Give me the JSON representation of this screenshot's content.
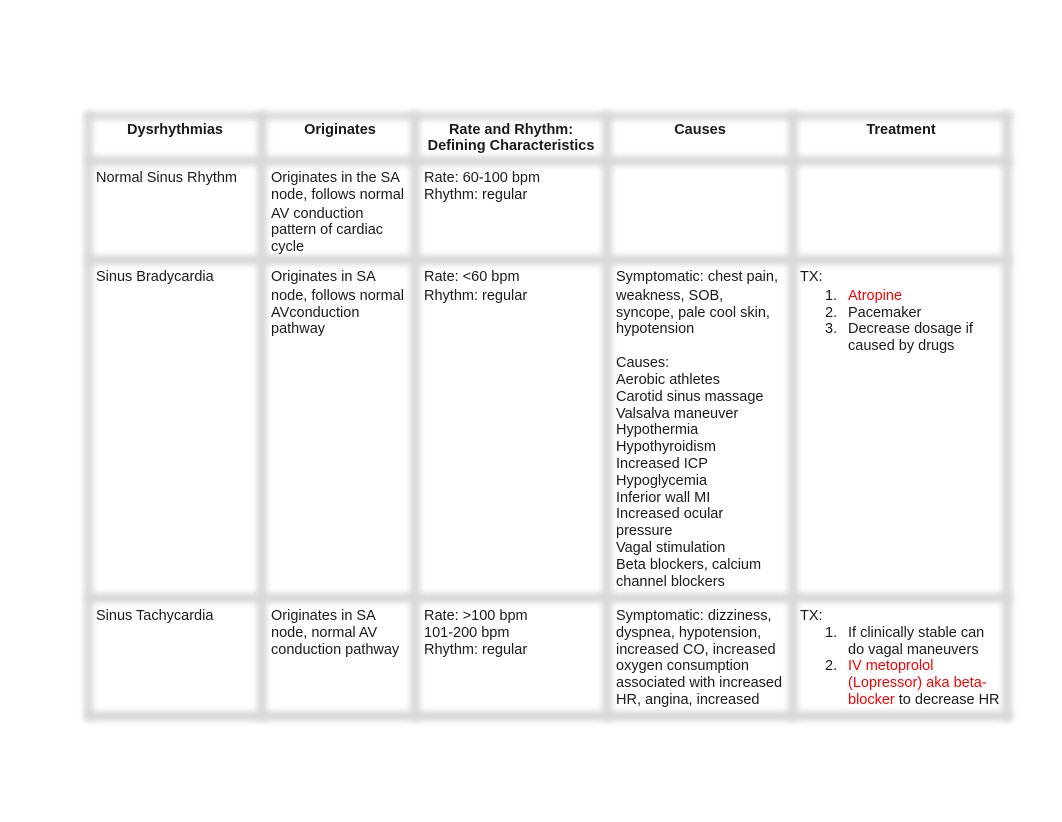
{
  "table": {
    "headers": [
      "Dysrhythmias",
      "Originates",
      "Rate and Rhythm: Defining Characteristics",
      "Causes",
      "Treatment"
    ],
    "header_rate_line1": "Rate and Rhythm:",
    "header_rate_line2": "Defining Characteristics",
    "rows": [
      {
        "name": "Normal Sinus Rhythm",
        "originates": [
          "Originates in the SA",
          "node, follows normal",
          "AV conduction",
          "pattern of cardiac",
          "cycle"
        ],
        "rate_rhythm": [
          "Rate: 60-100 bpm",
          "Rhythm: regular"
        ],
        "causes": [],
        "treatment": null
      },
      {
        "name": "Sinus Bradycardia",
        "originates": [
          "Originates in SA",
          "node, follows normal",
          "AVconduction",
          "pathway"
        ],
        "rate_rhythm": [
          "Rate: <60 bpm",
          "Rhythm: regular"
        ],
        "symptomatic": [
          "Symptomatic: chest pain,",
          "weakness, SOB,",
          "syncope, pale cool skin,",
          "hypotension"
        ],
        "causes_label": "Causes:",
        "causes": [
          "Aerobic athletes",
          "Carotid sinus massage",
          "Valsalva maneuver",
          "Hypothermia",
          "Hypothyroidism",
          "Increased ICP",
          "Hypoglycemia",
          "Inferior wall MI",
          "Increased ocular",
          "pressure",
          "Vagal stimulation",
          "Beta blockers, calcium",
          "channel blockers"
        ],
        "treatment": {
          "label": "TX:",
          "items": [
            {
              "num": "1.",
              "lines": [
                {
                  "text": "Atropine",
                  "red": true
                }
              ]
            },
            {
              "num": "2.",
              "lines": [
                {
                  "text": "Pacemaker",
                  "red": false
                }
              ]
            },
            {
              "num": "3.",
              "lines": [
                {
                  "text": "Decrease dosage if",
                  "red": false
                },
                {
                  "text": "caused by drugs",
                  "red": false
                }
              ]
            }
          ]
        }
      },
      {
        "name": "Sinus Tachycardia",
        "originates": [
          "Originates in SA",
          "node, normal AV",
          "conduction pathway"
        ],
        "rate_rhythm": [
          "Rate: >100 bpm",
          "101-200 bpm",
          "Rhythm: regular"
        ],
        "symptomatic": [
          "Symptomatic: dizziness,",
          "dyspnea, hypotension,",
          "increased CO, increased",
          "oxygen consumption",
          "associated with increased",
          "HR, angina, increased"
        ],
        "treatment": {
          "label": "TX:",
          "items": [
            {
              "num": "1.",
              "lines": [
                {
                  "text": "If clinically stable can",
                  "red": false
                },
                {
                  "text": "do vagal maneuvers",
                  "red": false
                }
              ]
            },
            {
              "num": "2.",
              "lines": [
                {
                  "text": "IV metoprolol",
                  "red": true
                },
                {
                  "text": "(Lopressor) aka beta-",
                  "red": true
                },
                {
                  "text": "blocker",
                  "red": true,
                  "tail": " to decrease HR"
                }
              ]
            }
          ]
        }
      }
    ]
  }
}
